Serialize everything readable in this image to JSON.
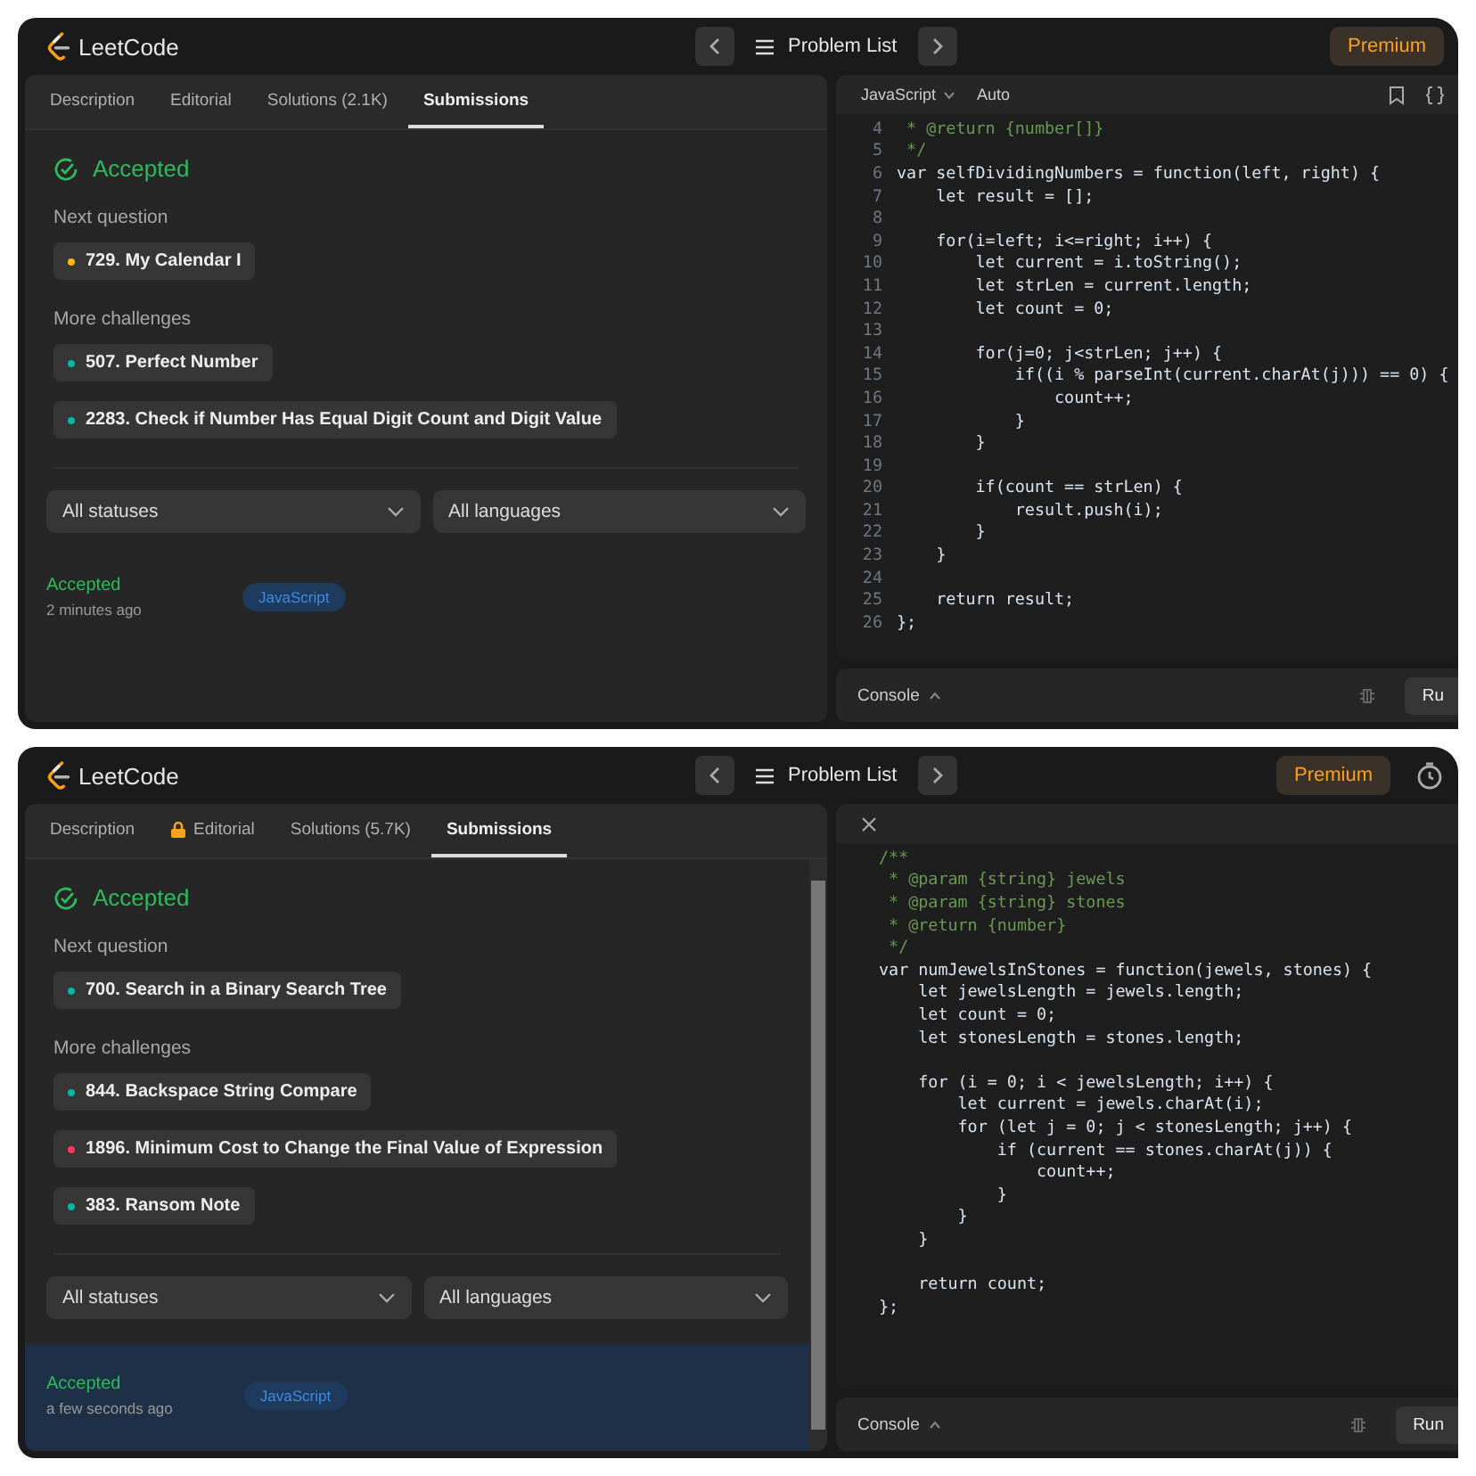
{
  "screens": [
    {
      "header": {
        "logo": "LeetCode",
        "problem_list": "Problem List",
        "premium": "Premium"
      },
      "tabs": [
        {
          "label": "Description",
          "selected": false,
          "locked": false
        },
        {
          "label": "Editorial",
          "selected": false,
          "locked": false
        },
        {
          "label": "Solutions (2.1K)",
          "selected": false,
          "locked": false
        },
        {
          "label": "Submissions",
          "selected": true,
          "locked": false
        }
      ],
      "status": "Accepted",
      "next_label": "Next question",
      "next": [
        {
          "title": "729. My Calendar I",
          "color": "#ffb800"
        }
      ],
      "more_label": "More challenges",
      "more": [
        {
          "title": "507. Perfect Number",
          "color": "#00b8a3"
        },
        {
          "title": "2283. Check if Number Has Equal Digit Count and Digit Value",
          "color": "#00b8a3"
        }
      ],
      "filters": [
        "All statuses",
        "All languages"
      ],
      "submission": {
        "status": "Accepted",
        "time": "2 minutes ago",
        "language": "JavaScript",
        "selected": false
      },
      "editor": {
        "header": {
          "kind": "toolbar",
          "language": "JavaScript",
          "mode": "Auto"
        },
        "lines": [
          {
            "number": "4",
            "kind": "comment",
            "text": " * @return {number[]}"
          },
          {
            "number": "5",
            "kind": "comment",
            "text": " */"
          },
          {
            "number": "6",
            "kind": "code",
            "text": "var selfDividingNumbers = function(left, right) {"
          },
          {
            "number": "7",
            "kind": "code",
            "text": "    let result = [];"
          },
          {
            "number": "8",
            "kind": "blank"
          },
          {
            "number": "9",
            "kind": "code",
            "text": "    for(i=left; i<=right; i++) {"
          },
          {
            "number": "10",
            "kind": "code",
            "text": "        let current = i.toString();"
          },
          {
            "number": "11",
            "kind": "code",
            "text": "        let strLen = current.length;"
          },
          {
            "number": "12",
            "kind": "code",
            "text": "        let count = 0;"
          },
          {
            "number": "13",
            "kind": "blank"
          },
          {
            "number": "14",
            "kind": "code",
            "text": "        for(j=0; j<strLen; j++) {"
          },
          {
            "number": "15",
            "kind": "code",
            "text": "            if((i % parseInt(current.charAt(j))) == 0) {"
          },
          {
            "number": "16",
            "kind": "code",
            "text": "                count++;"
          },
          {
            "number": "17",
            "kind": "code",
            "text": "            }"
          },
          {
            "number": "18",
            "kind": "code",
            "text": "        }"
          },
          {
            "number": "19",
            "kind": "blank"
          },
          {
            "number": "20",
            "kind": "code",
            "text": "        if(count == strLen) {"
          },
          {
            "number": "21",
            "kind": "code",
            "text": "            result.push(i);"
          },
          {
            "number": "22",
            "kind": "code",
            "text": "        }"
          },
          {
            "number": "23",
            "kind": "code",
            "text": "    }"
          },
          {
            "number": "24",
            "kind": "blank"
          },
          {
            "number": "25",
            "kind": "code",
            "text": "    return result;"
          },
          {
            "number": "26",
            "kind": "code",
            "text": "};"
          }
        ],
        "console": "Console",
        "run": "Ru"
      }
    },
    {
      "header": {
        "logo": "LeetCode",
        "problem_list": "Problem List",
        "premium": "Premium",
        "timer_icon": true
      },
      "tabs": [
        {
          "label": "Description",
          "selected": false,
          "locked": false
        },
        {
          "label": "Editorial",
          "selected": false,
          "locked": true
        },
        {
          "label": "Solutions (5.7K)",
          "selected": false,
          "locked": false
        },
        {
          "label": "Submissions",
          "selected": true,
          "locked": false
        }
      ],
      "status": "Accepted",
      "next_label": "Next question",
      "next": [
        {
          "title": "700. Search in a Binary Search Tree",
          "color": "#00b8a3"
        }
      ],
      "more_label": "More challenges",
      "more": [
        {
          "title": "844. Backspace String Compare",
          "color": "#00b8a3"
        },
        {
          "title": "1896. Minimum Cost to Change the Final Value of Expression",
          "color": "#ff375f"
        },
        {
          "title": "383. Ransom Note",
          "color": "#00b8a3"
        }
      ],
      "filters": [
        "All statuses",
        "All languages"
      ],
      "submission": {
        "status": "Accepted",
        "time": "a few seconds ago",
        "language": "JavaScript",
        "selected": true
      },
      "scrollbar": true,
      "editor": {
        "header": {
          "kind": "close"
        },
        "lines": [
          {
            "kind": "comment",
            "text": "/**"
          },
          {
            "kind": "comment",
            "text": " * @param {string} jewels"
          },
          {
            "kind": "comment",
            "text": " * @param {string} stones"
          },
          {
            "kind": "comment",
            "text": " * @return {number}"
          },
          {
            "kind": "comment",
            "text": " */"
          },
          {
            "kind": "code",
            "text": "var numJewelsInStones = function(jewels, stones) {"
          },
          {
            "kind": "code",
            "text": "    let jewelsLength = jewels.length;"
          },
          {
            "kind": "code",
            "text": "    let count = 0;"
          },
          {
            "kind": "code",
            "text": "    let stonesLength = stones.length;"
          },
          {
            "kind": "blank"
          },
          {
            "kind": "code",
            "text": "    for (i = 0; i < jewelsLength; i++) {"
          },
          {
            "kind": "code",
            "text": "        let current = jewels.charAt(i);"
          },
          {
            "kind": "code",
            "text": "        for (let j = 0; j < stonesLength; j++) {"
          },
          {
            "kind": "code",
            "text": "            if (current == stones.charAt(j)) {"
          },
          {
            "kind": "code",
            "text": "                count++;"
          },
          {
            "kind": "code",
            "text": "            }"
          },
          {
            "kind": "code",
            "text": "        }"
          },
          {
            "kind": "code",
            "text": "    }"
          },
          {
            "kind": "blank"
          },
          {
            "kind": "code",
            "text": "    return count;"
          },
          {
            "kind": "code",
            "text": "};"
          }
        ],
        "console": "Console",
        "run": "Run"
      }
    }
  ]
}
